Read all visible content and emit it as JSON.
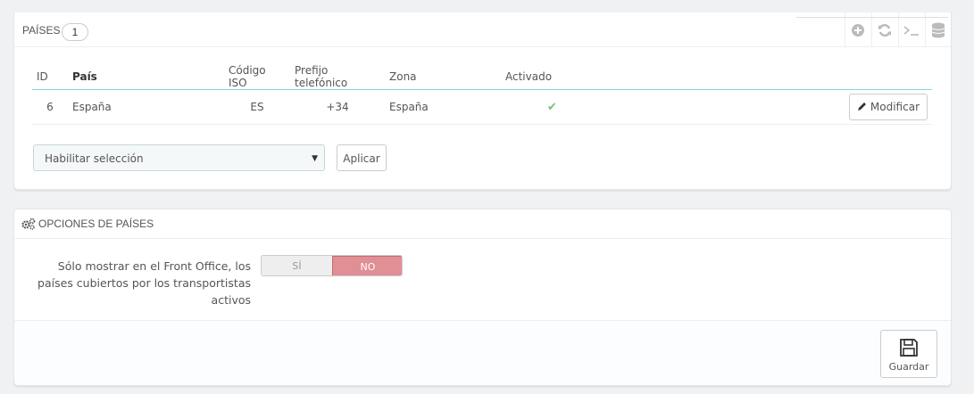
{
  "countries_panel": {
    "title": "PAÍSES",
    "count": "1",
    "toolbar": [
      {
        "icon": "plus-circle-icon"
      },
      {
        "icon": "refresh-icon"
      },
      {
        "icon": "terminal-icon"
      },
      {
        "icon": "database-icon"
      }
    ],
    "columns": {
      "id": "ID",
      "country": "País",
      "iso": "Código ISO",
      "prefix": "Prefijo telefónico",
      "zone": "Zona",
      "enabled": "Activado"
    },
    "rows": [
      {
        "id": "6",
        "country": "España",
        "iso": "ES",
        "prefix": "+34",
        "zone": "España",
        "enabled": "✔",
        "action": "Modificar"
      }
    ],
    "bulk_select": "Habilitar selección",
    "apply": "Aplicar"
  },
  "options_panel": {
    "title": "OPCIONES DE PAÍSES",
    "option_label": "Sólo mostrar en el Front Office, los países cubiertos por los transportistas activos",
    "switch_yes": "SÍ",
    "switch_no": "NO",
    "switch_selected": "NO",
    "save": "Guardar"
  },
  "colors": {
    "accent_line": "#88d3e0",
    "switch_off": "#e08f95",
    "check_green": "#72c279"
  }
}
